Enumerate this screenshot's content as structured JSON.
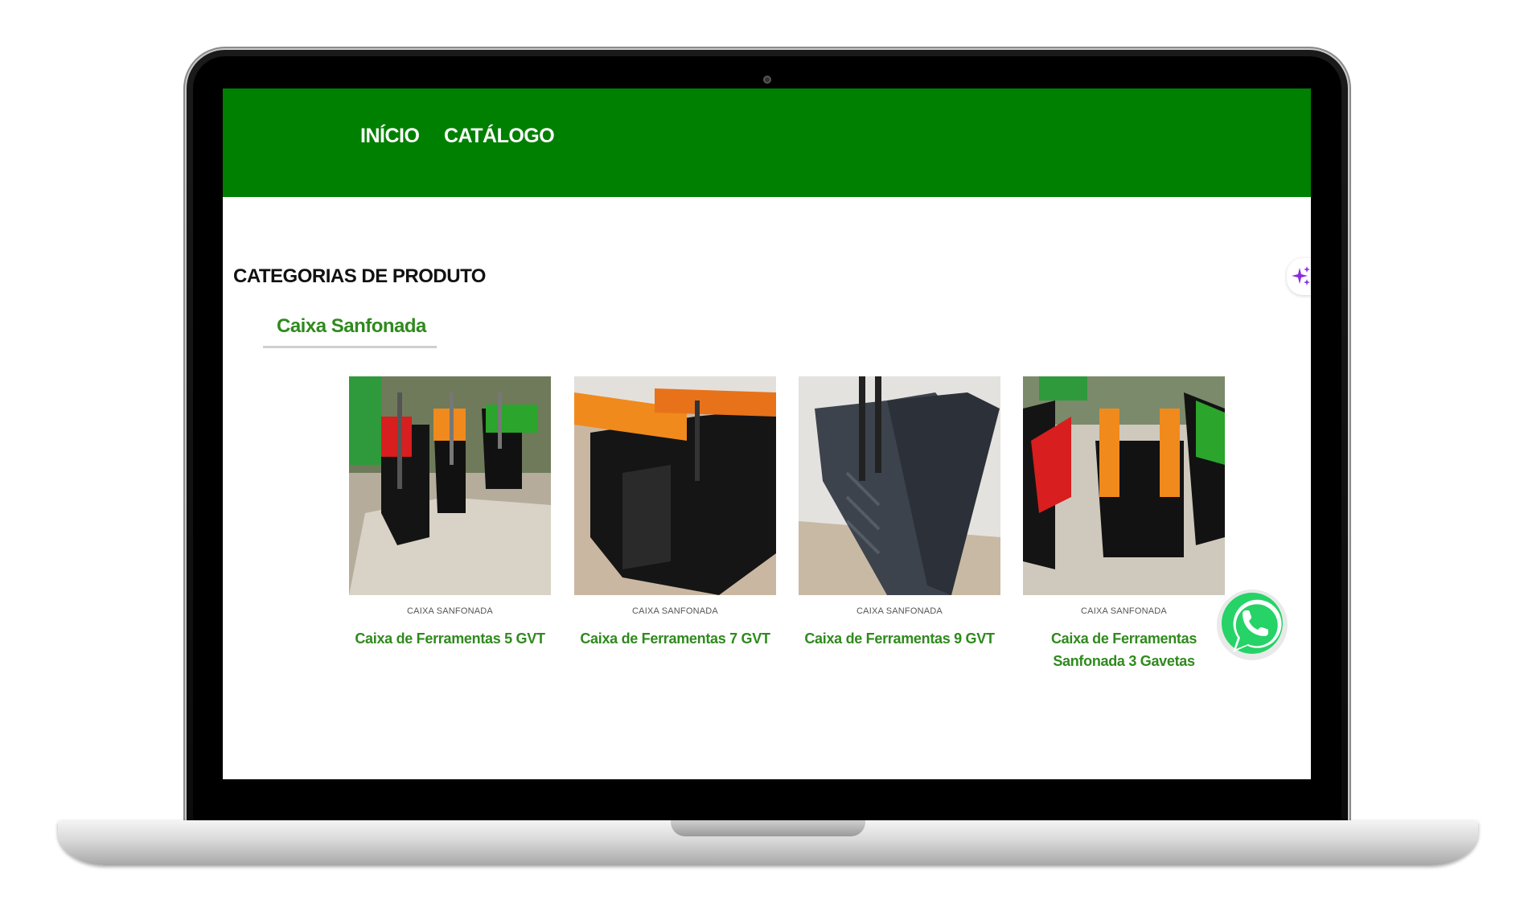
{
  "nav": {
    "items": [
      {
        "label": "INÍCIO"
      },
      {
        "label": "CATÁLOGO"
      }
    ]
  },
  "main": {
    "section_title": "CATEGORIAS DE PRODUTO",
    "active_tab": "Caixa Sanfonada",
    "products": [
      {
        "category": "CAIXA SANFONADA",
        "title": "Caixa de Ferramentas 5 GVT"
      },
      {
        "category": "CAIXA SANFONADA",
        "title": "Caixa de Ferramentas 7 GVT"
      },
      {
        "category": "CAIXA SANFONADA",
        "title": "Caixa de Ferramentas 9 GVT"
      },
      {
        "category": "CAIXA SANFONADA",
        "title": "Caixa de Ferramentas Sanfonada 3 Gavetas"
      }
    ]
  },
  "icons": {
    "sparkle": "sparkle-icon",
    "whatsapp": "whatsapp-icon"
  },
  "colors": {
    "header_bg": "#008000",
    "accent_green": "#2f8a1d",
    "whatsapp_green": "#25d366",
    "sparkle_purple": "#8a2be2"
  }
}
